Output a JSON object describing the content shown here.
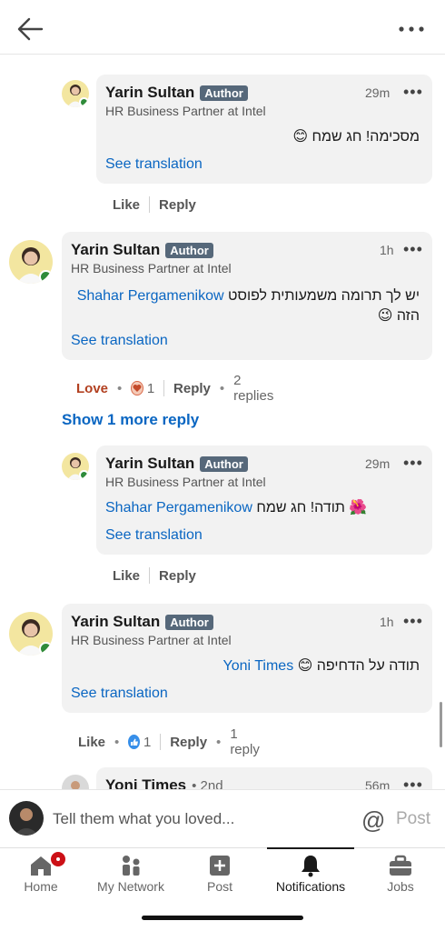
{
  "header": {
    "back_icon": "arrow-left-icon",
    "more_icon": "more-horizontal-icon"
  },
  "comments": [
    {
      "name": "Yarin Sultan",
      "badge": "Author",
      "time": "29m",
      "headline": "HR Business Partner at Intel",
      "text": "מסכימה! חג שמח",
      "emoji": "😊",
      "see_translation": "See translation",
      "like": "Like",
      "reply": "Reply"
    },
    {
      "name": "Yarin Sultan",
      "badge": "Author",
      "time": "1h",
      "headline": "HR Business Partner at Intel",
      "mention": "Shahar Pergamenikow",
      "text_line1": "יש לך תרומה משמעותית לפוסט",
      "text_line2": "הזה",
      "emoji": "😉",
      "see_translation": "See translation",
      "reaction_label": "Love",
      "reaction_count": "1",
      "reply": "Reply",
      "replies": "2 replies"
    },
    {
      "name": "Yarin Sultan",
      "badge": "Author",
      "time": "29m",
      "headline": "HR Business Partner at Intel",
      "mention": "Shahar Pergamenikow",
      "text": "תודה! חג שמח",
      "emoji": "🌺",
      "see_translation": "See translation",
      "like": "Like",
      "reply": "Reply"
    },
    {
      "name": "Yarin Sultan",
      "badge": "Author",
      "time": "1h",
      "headline": "HR Business Partner at Intel",
      "mention": "Yoni Times",
      "text": "תודה על הדחיפה",
      "emoji": "😊",
      "see_translation": "See translation",
      "like": "Like",
      "reaction_count": "1",
      "reply": "Reply",
      "replies": "1 reply"
    },
    {
      "name": "Yoni Times",
      "degree": "• 2nd",
      "time": "56m"
    }
  ],
  "show_more_reply": "Show 1 more reply",
  "composer": {
    "placeholder": "Tell them what you loved...",
    "at_symbol": "@",
    "post": "Post"
  },
  "tabs": [
    {
      "label": "Home",
      "icon": "home-icon"
    },
    {
      "label": "My Network",
      "icon": "network-icon"
    },
    {
      "label": "Post",
      "icon": "plus-square-icon"
    },
    {
      "label": "Notifications",
      "icon": "bell-icon",
      "active": true
    },
    {
      "label": "Jobs",
      "icon": "briefcase-icon"
    }
  ],
  "colors": {
    "accent": "#0a66c2",
    "badge": "#56687a",
    "online": "#2f8b3a",
    "love": "#b24020"
  }
}
